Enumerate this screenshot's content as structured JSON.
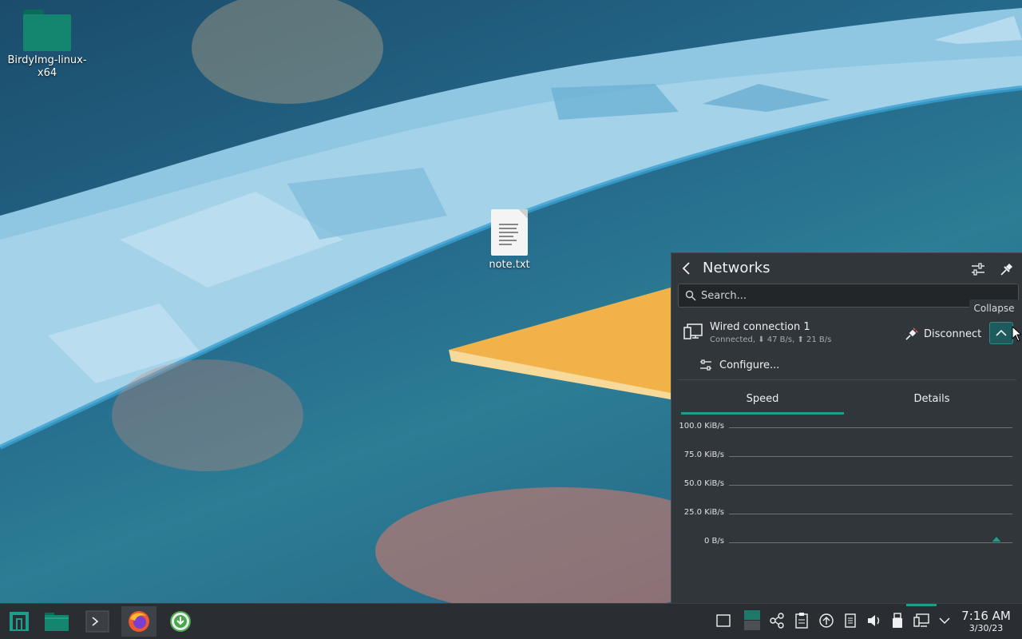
{
  "desktop": {
    "icons": [
      {
        "label": "BirdyImg-linux-x64",
        "icon": "folder-icon"
      },
      {
        "label": "note.txt",
        "icon": "text-file-icon"
      }
    ]
  },
  "networks_popup": {
    "title": "Networks",
    "search_placeholder": "Search...",
    "tooltip": "Collapse",
    "connection": {
      "name": "Wired connection 1",
      "status": "Connected, ⬇ 47 B/s, ⬆ 21 B/s",
      "disconnect_label": "Disconnect"
    },
    "configure_label": "Configure...",
    "tabs": [
      "Speed",
      "Details"
    ],
    "active_tab": "Speed",
    "graph": {
      "y_ticks": [
        "100.0 KiB/s",
        "75.0 KiB/s",
        "50.0 KiB/s",
        "25.0 KiB/s",
        "0 B/s"
      ]
    }
  },
  "chart_data": {
    "type": "line",
    "title": "",
    "xlabel": "",
    "ylabel": "",
    "ylim": [
      0,
      100
    ],
    "y_unit": "KiB/s",
    "y_ticks": [
      "100.0 KiB/s",
      "75.0 KiB/s",
      "50.0 KiB/s",
      "25.0 KiB/s",
      "0 B/s"
    ],
    "series": [
      {
        "values": [
          0,
          0,
          0,
          0.2
        ]
      }
    ],
    "grid": true,
    "accent_color": "#1d9e8b"
  },
  "taskbar": {
    "launchers": [
      "application-launcher-icon",
      "file-manager-icon",
      "terminal-icon",
      "firefox-icon",
      "download-icon"
    ],
    "tray": [
      "show-desktop-icon",
      "pager-icon",
      "network-share-icon",
      "clipboard-icon",
      "updates-icon",
      "notes-icon",
      "volume-icon",
      "usb-icon",
      "network-icon",
      "expand-tray-icon"
    ],
    "clock": {
      "time": "7:16 AM",
      "date": "3/30/23"
    }
  },
  "colors": {
    "panel_bg": "#31363b",
    "accent": "#1d9e8b",
    "taskbar_bg": "#2a2e32"
  }
}
